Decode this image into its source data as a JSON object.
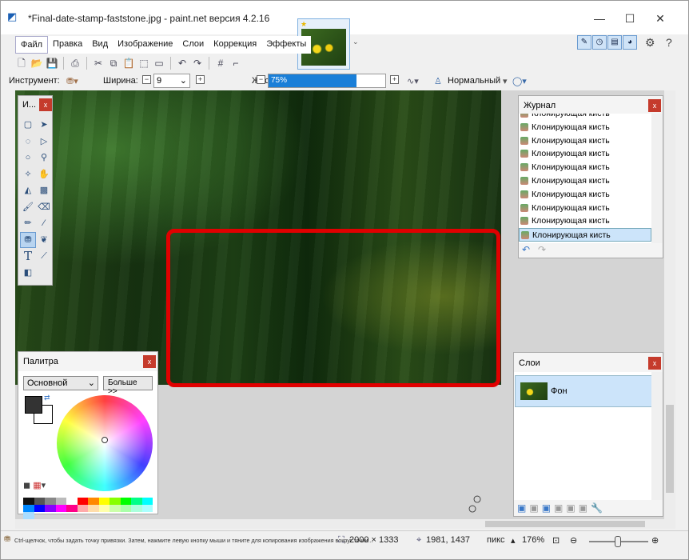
{
  "window": {
    "title": "*Final-date-stamp-faststone.jpg - paint.net версия 4.2.16",
    "minimize": "—",
    "maximize": "☐",
    "close": "✕"
  },
  "menu": [
    "Файл",
    "Правка",
    "Вид",
    "Изображение",
    "Слои",
    "Коррекция",
    "Эффекты"
  ],
  "toolbar": {
    "tool_label": "Инструмент:",
    "width_label": "Ширина:",
    "width_value": "9",
    "hardness_label": "Жесткость:",
    "hardness_value": "75%",
    "hardness_percent": 75,
    "blend_mode": "Нормальный"
  },
  "tools_panel": {
    "title": "И..."
  },
  "journal": {
    "title": "Журнал",
    "items": [
      "Клонирующая кисть",
      "Клонирующая кисть",
      "Клонирующая кисть",
      "Клонирующая кисть",
      "Клонирующая кисть",
      "Клонирующая кисть",
      "Клонирующая кисть",
      "Клонирующая кисть",
      "Клонирующая кисть",
      "Клонирующая кисть"
    ]
  },
  "palette": {
    "title": "Палитра",
    "mode": "Основной",
    "more": "Больше >>"
  },
  "layers": {
    "title": "Слои",
    "layer_name": "Фон",
    "checked": "✓"
  },
  "status": {
    "hint": "Ctrl-щелчок, чтобы задать точку привязки. Затем, нажмите левую кнопку мыши и тяните для копирования изображения вокруг точки...",
    "image_size": "2000 × 1333",
    "cursor_pos": "1981, 1437",
    "units": "пикс",
    "zoom": "176%"
  },
  "colors": {
    "accent": "#1a7fd8",
    "highlight": "#e00000",
    "close": "#c53b2c"
  }
}
